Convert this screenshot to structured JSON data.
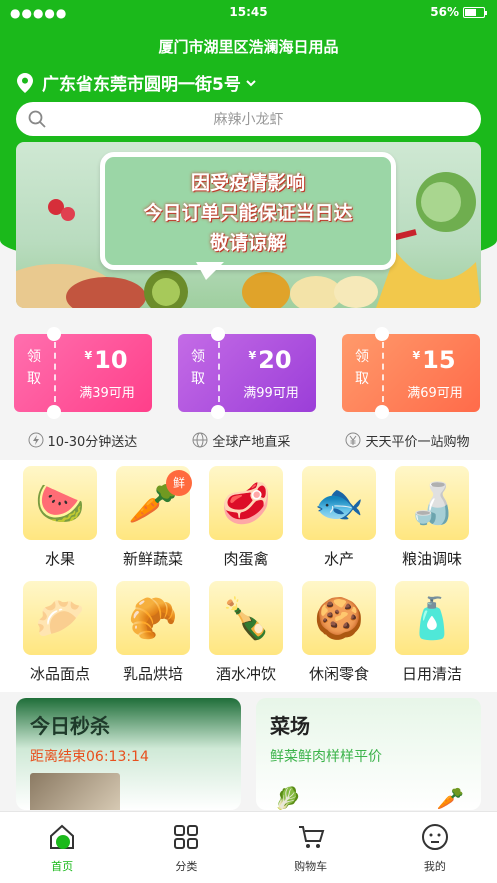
{
  "status_bar": {
    "signal": "●●●●●",
    "time": "15:45",
    "battery": "56%"
  },
  "header": {
    "store_name": "厦门市湖里区浩澜海日用品",
    "location": "广东省东莞市圆明一街5号",
    "search_placeholder": "麻辣小龙虾"
  },
  "banner": {
    "lines": [
      "因受疫情影响",
      "今日订单只能保证当日达",
      "敬请谅解"
    ]
  },
  "coupons": [
    {
      "stub": [
        "领",
        "取"
      ],
      "currency": "¥",
      "amount": "10",
      "condition": "满39可用",
      "color_start": "#ff6fae",
      "color_end": "#ff3f8a"
    },
    {
      "stub": [
        "领",
        "取"
      ],
      "currency": "¥",
      "amount": "20",
      "condition": "满99可用",
      "color_start": "#c46be6",
      "color_end": "#9b3ed8"
    },
    {
      "stub": [
        "领",
        "取"
      ],
      "currency": "¥",
      "amount": "15",
      "condition": "满69可用",
      "color_start": "#ff9a6b",
      "color_end": "#ff6b4a"
    }
  ],
  "features": [
    {
      "icon": "lightning-icon",
      "label": "10-30分钟送达"
    },
    {
      "icon": "globe-icon",
      "label": "全球产地直采"
    },
    {
      "icon": "yen-icon",
      "label": "天天平价一站购物"
    }
  ],
  "categories": [
    {
      "label": "水果",
      "icon": "🍉"
    },
    {
      "label": "新鲜蔬菜",
      "icon": "🥕",
      "tag": "鲜"
    },
    {
      "label": "肉蛋禽",
      "icon": "🥩"
    },
    {
      "label": "水产",
      "icon": "🐟"
    },
    {
      "label": "粮油调味",
      "icon": "🍶"
    },
    {
      "label": "冰品面点",
      "icon": "🥟"
    },
    {
      "label": "乳品烘培",
      "icon": "🥐"
    },
    {
      "label": "酒水冲饮",
      "icon": "🍾"
    },
    {
      "label": "休闲零食",
      "icon": "🍪"
    },
    {
      "label": "日用清洁",
      "icon": "🧴"
    }
  ],
  "promos": {
    "flash_sale": {
      "title": "今日秒杀",
      "countdown": "距离结束06:13:14"
    },
    "market": {
      "title": "菜场",
      "subtitle": "鲜菜鲜肉样样平价"
    }
  },
  "tabbar": [
    {
      "label": "首页",
      "icon": "home-icon",
      "active": true
    },
    {
      "label": "分类",
      "icon": "grid-icon",
      "active": false
    },
    {
      "label": "购物车",
      "icon": "cart-icon",
      "active": false
    },
    {
      "label": "我的",
      "icon": "profile-icon",
      "active": false
    }
  ],
  "colors": {
    "brand_green": "#1bb91b",
    "countdown_orange": "#e8501e",
    "accent_green": "#3bb34a"
  }
}
